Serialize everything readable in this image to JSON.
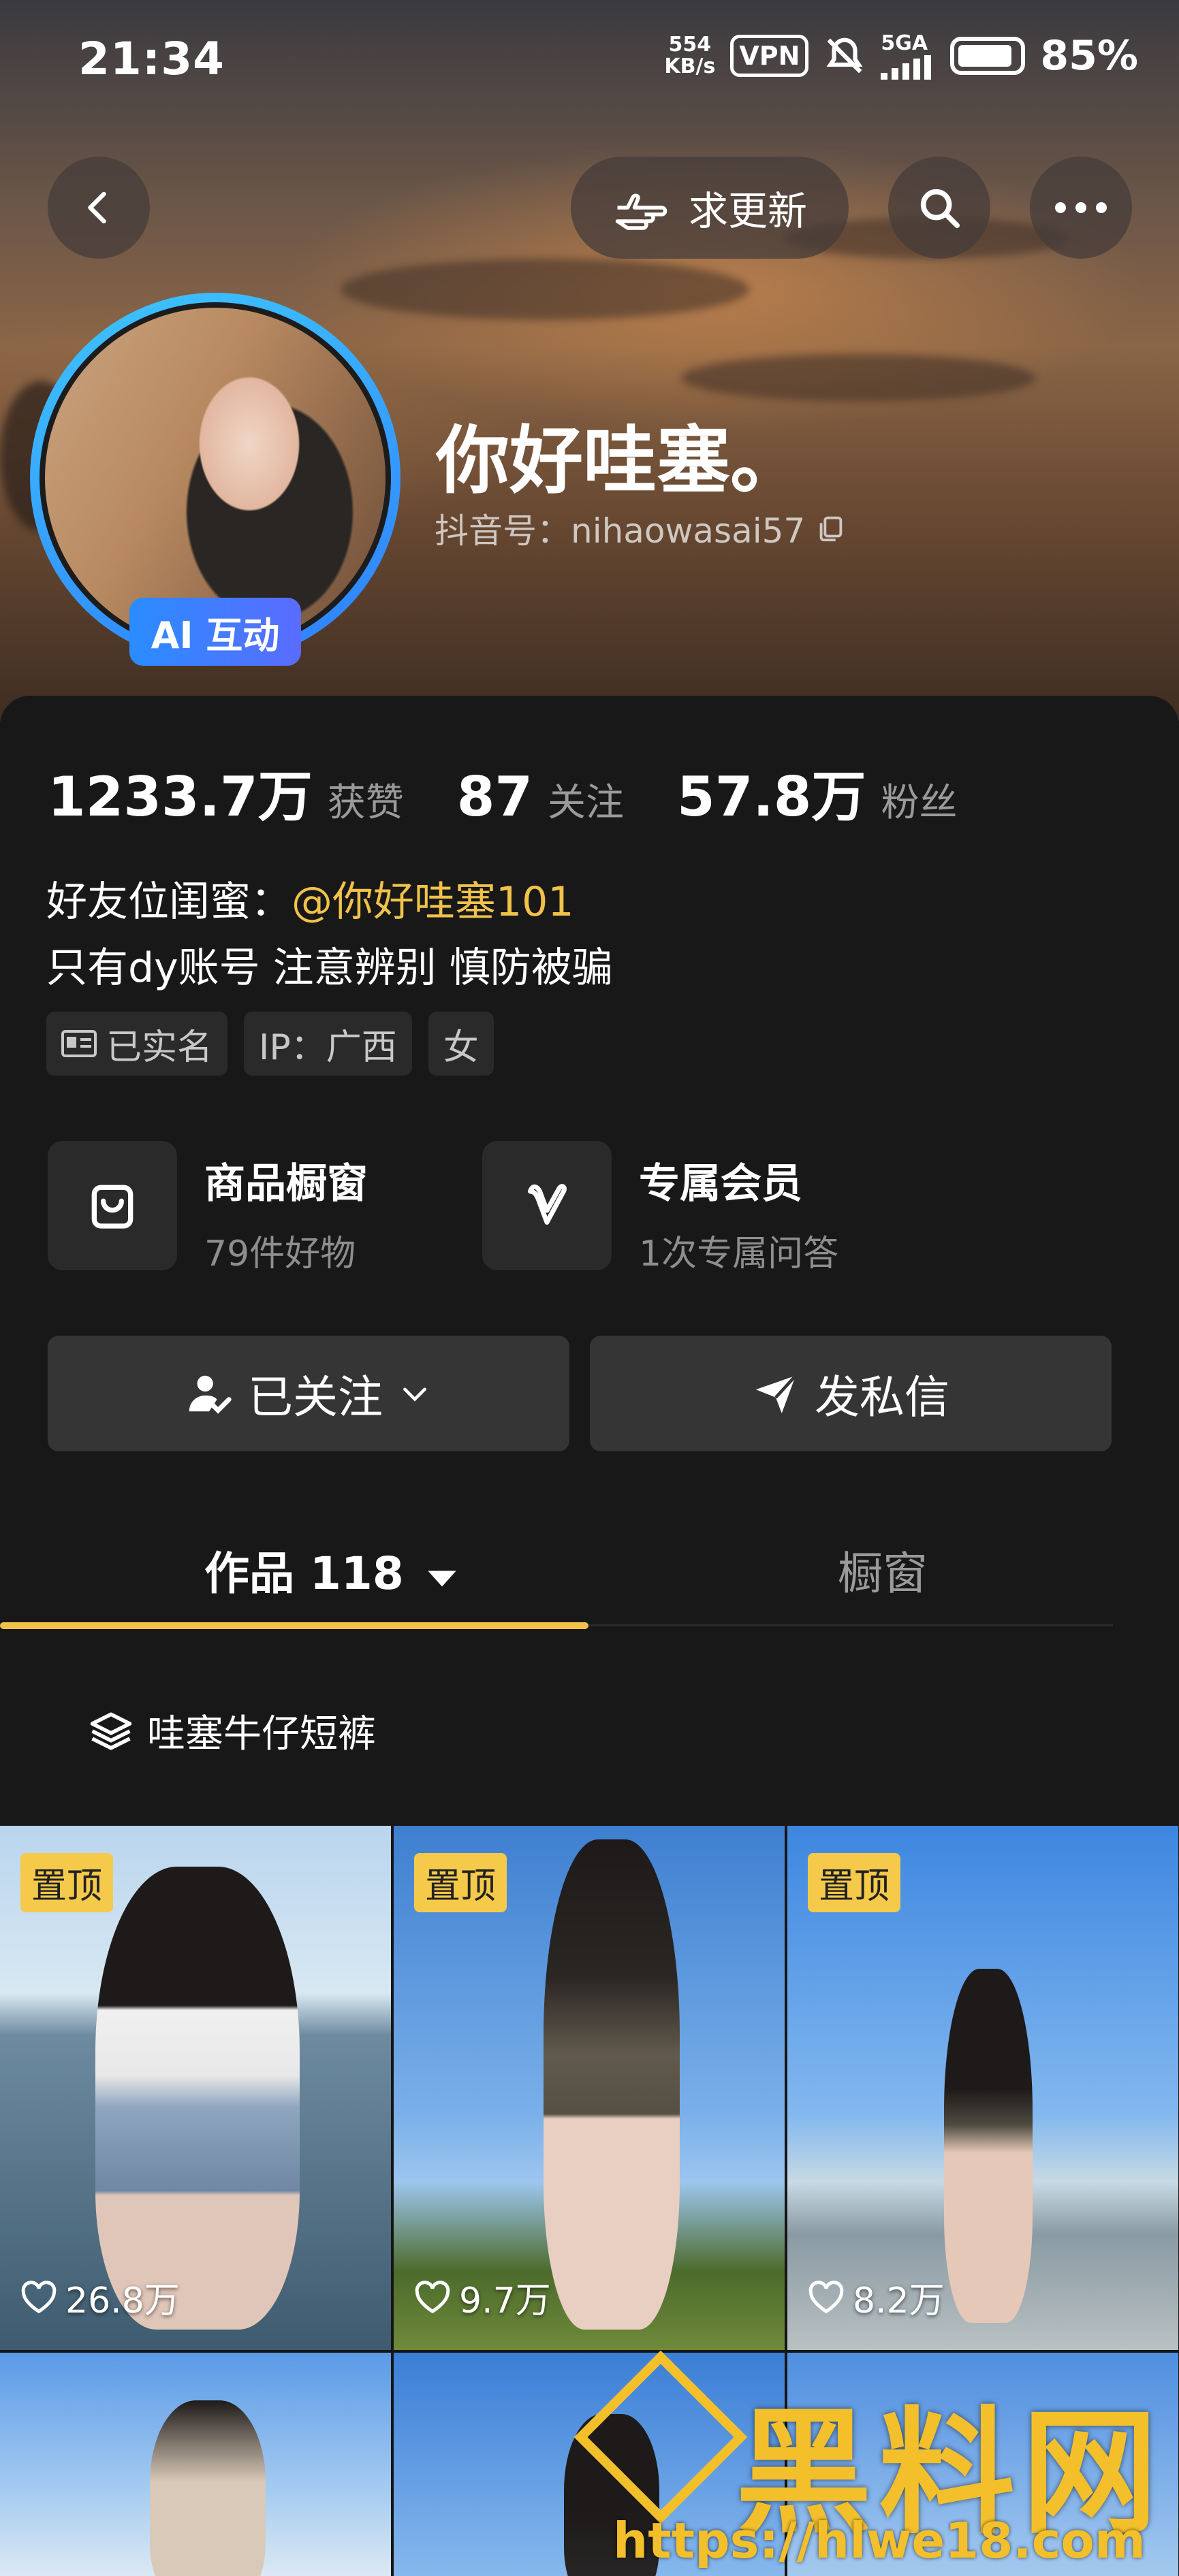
{
  "status": {
    "time": "21:34",
    "speed": "554\nKB/s",
    "vpn": "VPN",
    "network": "5GA",
    "battery": "85%"
  },
  "nav": {
    "request_update": "求更新"
  },
  "profile": {
    "badge": "AI 互动",
    "name": "你好哇塞。",
    "handle": "抖音号：nihaowasai57"
  },
  "stats": [
    {
      "value": "1233.7万",
      "label": "获赞"
    },
    {
      "value": "87",
      "label": "关注"
    },
    {
      "value": "57.8万",
      "label": "粉丝"
    }
  ],
  "bio": {
    "line1_prefix": "好友位闺蜜：",
    "line1_mention": "@你好哇塞101",
    "line2": "只有dy账号 注意辨别 慎防被骗"
  },
  "tags": [
    "已实名",
    "IP：广西",
    "女"
  ],
  "services": [
    {
      "title": "商品橱窗",
      "subtitle": "79件好物",
      "icon": "shopping-bag-icon"
    },
    {
      "title": "专属会员",
      "subtitle": "1次专属问答",
      "icon": "v-member-icon"
    }
  ],
  "actions": {
    "follow": "已关注",
    "message": "发私信"
  },
  "tabs": {
    "works": "作品 118",
    "showcase": "橱窗"
  },
  "collection": "哇塞牛仔短裤",
  "posts": [
    {
      "pinned": "置顶",
      "likes": "26.8万"
    },
    {
      "pinned": "置顶",
      "likes": "9.7万"
    },
    {
      "pinned": "置顶",
      "likes": "8.2万"
    }
  ],
  "watermark": {
    "brand": "黑料网",
    "url": "https://hlwe18.com"
  },
  "colors": {
    "accent": "#f1c24a",
    "panel": "#181818",
    "avatar_ring": "#2f9bff"
  }
}
